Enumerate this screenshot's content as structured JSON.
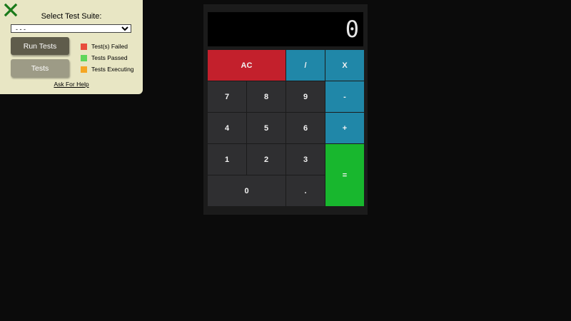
{
  "test_panel": {
    "title": "Select Test Suite:",
    "suite_select": {
      "value": "- - -",
      "options": [
        "- - -"
      ]
    },
    "run_button_label": "Run Tests",
    "tests_button_label": "Tests",
    "legend": [
      {
        "label": "Test(s) Failed",
        "color": "#e84c3d"
      },
      {
        "label": "Tests Passed",
        "color": "#5fd65a"
      },
      {
        "label": "Tests Executing",
        "color": "#f5a623"
      }
    ],
    "help_link": "Ask For Help",
    "close_icon_color": "#1a7a1a"
  },
  "calculator": {
    "display": "0",
    "keys": {
      "clear": "AC",
      "divide": "/",
      "multiply": "X",
      "seven": "7",
      "eight": "8",
      "nine": "9",
      "subtract": "-",
      "four": "4",
      "five": "5",
      "six": "6",
      "add": "+",
      "one": "1",
      "two": "2",
      "three": "3",
      "equals": "=",
      "zero": "0",
      "decimal": "."
    },
    "colors": {
      "clear": "#c3202c",
      "operator": "#2087a8",
      "equals": "#18b72e",
      "number": "#2f2f31"
    }
  }
}
